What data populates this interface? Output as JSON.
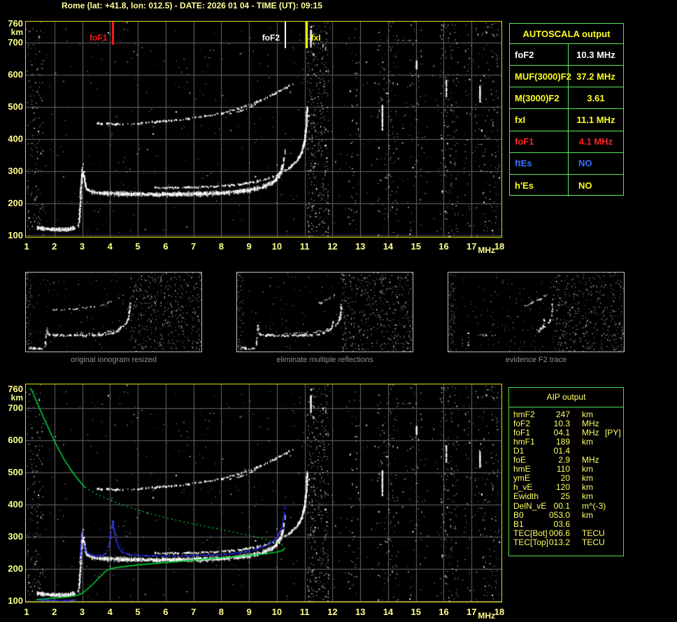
{
  "title": "Rome (lat: +41.8, lon: 012.5) - DATE: 2026 01 04 - TIME (UT): 09:15",
  "axis": {
    "x_ticks": [
      "1",
      "2",
      "3",
      "4",
      "5",
      "6",
      "7",
      "8",
      "9",
      "10",
      "11",
      "12",
      "13",
      "14",
      "15",
      "16",
      "17",
      "18"
    ],
    "y_ticks": [
      "760",
      "700",
      "600",
      "500",
      "400",
      "300",
      "200",
      "100"
    ],
    "x_unit": "MHz",
    "y_unit": "km"
  },
  "top_plot": {
    "markers": [
      {
        "label": "foF1",
        "f": 4.08,
        "color": "#ff1616",
        "side": "left",
        "len": 33,
        "w": 3
      },
      {
        "label": "foF2",
        "f": 10.28,
        "color": "#ffffff",
        "side": "left",
        "len": 38,
        "w": 2
      },
      {
        "label": "fxI",
        "f": 11.05,
        "color": "#ffff00",
        "side": "right",
        "len": 38,
        "w": 3
      }
    ]
  },
  "autoscala": {
    "header": "AUTOSCALA output",
    "rows": [
      {
        "label": "foF2",
        "value": "10.3 MHz",
        "color": "#ffffff",
        "align": "center"
      },
      {
        "label": "MUF(3000)F2",
        "value": "37.2 MHz",
        "color": "#ffff22",
        "align": "center"
      },
      {
        "label": "M(3000)F2",
        "value": "3.61",
        "color": "#ffff22",
        "align": "center"
      },
      {
        "label": "fxI",
        "value": "11.1 MHz",
        "color": "#ffff22",
        "align": "center"
      },
      {
        "label": "foF1",
        "value": "4.1 MHz",
        "color": "#ff2020",
        "align": "center"
      },
      {
        "label": "ftEs",
        "value": "NO",
        "color": "#3b6eff",
        "align": "left"
      },
      {
        "label": "h'Es",
        "value": "NO",
        "color": "#ffff22",
        "align": "left"
      }
    ]
  },
  "thumbnails": [
    {
      "caption": "original ionogram resized"
    },
    {
      "caption": "eliminate multiple reflections"
    },
    {
      "caption": "evidence F2 trace"
    }
  ],
  "aip": {
    "header": "AIP output",
    "rows": [
      {
        "label": "hmF2",
        "value": "247",
        "unit": "km",
        "extra": ""
      },
      {
        "label": "foF2",
        "value": "10.3",
        "unit": "MHz",
        "extra": ""
      },
      {
        "label": "foF1",
        "value": "04.1",
        "unit": "MHz",
        "extra": "[PY]"
      },
      {
        "label": "hmF1",
        "value": "189",
        "unit": "km",
        "extra": ""
      },
      {
        "label": "D1",
        "value": "01.4",
        "unit": "",
        "extra": ""
      },
      {
        "label": "foE",
        "value": "2.9",
        "unit": "MHz",
        "extra": ""
      },
      {
        "label": "hmE",
        "value": "110",
        "unit": "km",
        "extra": ""
      },
      {
        "label": "ymE",
        "value": "20",
        "unit": "km",
        "extra": ""
      },
      {
        "label": "h_vE",
        "value": "120",
        "unit": "km",
        "extra": ""
      },
      {
        "label": "Ewidth",
        "value": "25",
        "unit": "km",
        "extra": ""
      },
      {
        "label": "DelN_vE",
        "value": "00.1",
        "unit": "m^(-3)",
        "extra": ""
      },
      {
        "label": "B0",
        "value": "053.0",
        "unit": "km",
        "extra": ""
      },
      {
        "label": "B1",
        "value": "03.6",
        "unit": "",
        "extra": ""
      },
      {
        "label": "TEC[Bot]",
        "value": "006.6",
        "unit": "TECU",
        "extra": ""
      },
      {
        "label": "TEC[Top]",
        "value": "013.2",
        "unit": "TECU",
        "extra": ""
      }
    ]
  },
  "chart_data": {
    "type": "scatter",
    "title": "vertical incidence ionogram",
    "x_unit": "MHz",
    "y_unit": "km",
    "x_range": [
      1,
      18
    ],
    "y_range": [
      100,
      760
    ],
    "scaled_values": {
      "foF2_MHz": 10.3,
      "MUF3000F2_MHz": 37.2,
      "M3000F2": 3.61,
      "fxI_MHz": 11.1,
      "foF1_MHz": 4.1,
      "ftEs": "NO",
      "h_Es": "NO"
    },
    "traces": {
      "e_layer": [
        [
          1.4,
          124
        ],
        [
          1.6,
          121
        ],
        [
          1.9,
          119
        ],
        [
          2.2,
          118
        ],
        [
          2.5,
          119
        ],
        [
          2.75,
          122
        ]
      ],
      "f_cusp": [
        [
          2.86,
          128
        ],
        [
          2.9,
          150
        ],
        [
          2.92,
          180
        ],
        [
          2.94,
          215
        ],
        [
          2.96,
          250
        ],
        [
          2.99,
          285
        ],
        [
          3.02,
          315
        ],
        [
          3.04,
          330
        ]
      ],
      "f_desc": [
        [
          3.05,
          298
        ],
        [
          3.09,
          268
        ],
        [
          3.14,
          250
        ],
        [
          3.22,
          241
        ],
        [
          3.35,
          235
        ]
      ],
      "f_flat": [
        [
          3.35,
          235
        ],
        [
          3.8,
          231
        ],
        [
          4.5,
          229
        ],
        [
          5.5,
          228
        ],
        [
          6.5,
          228
        ],
        [
          7.5,
          230
        ],
        [
          8.2,
          233
        ],
        [
          8.8,
          238
        ],
        [
          9.2,
          244
        ],
        [
          9.5,
          251
        ],
        [
          9.75,
          260
        ],
        [
          9.95,
          272
        ],
        [
          10.1,
          288
        ],
        [
          10.18,
          305
        ],
        [
          10.24,
          325
        ],
        [
          10.27,
          350
        ],
        [
          10.29,
          378
        ]
      ],
      "x_mode": [
        [
          5.6,
          249
        ],
        [
          6.3,
          248
        ],
        [
          7.0,
          249
        ],
        [
          7.7,
          251
        ],
        [
          8.3,
          255
        ],
        [
          8.8,
          260
        ],
        [
          9.2,
          266
        ],
        [
          9.6,
          274
        ],
        [
          9.9,
          283
        ],
        [
          10.2,
          296
        ],
        [
          10.5,
          313
        ],
        [
          10.75,
          335
        ],
        [
          10.9,
          360
        ],
        [
          11.0,
          392
        ],
        [
          11.05,
          430
        ],
        [
          11.08,
          470
        ],
        [
          11.1,
          500
        ]
      ],
      "hop2": [
        [
          3.35,
          452
        ],
        [
          3.7,
          448
        ],
        [
          4.2,
          446
        ],
        [
          4.8,
          447
        ],
        [
          5.5,
          451
        ],
        [
          6.2,
          457
        ],
        [
          6.8,
          463
        ],
        [
          7.4,
          470
        ],
        [
          7.9,
          478
        ],
        [
          8.4,
          489
        ],
        [
          8.9,
          502
        ],
        [
          9.3,
          515
        ],
        [
          9.7,
          530
        ],
        [
          10.05,
          546
        ],
        [
          10.35,
          560
        ],
        [
          10.6,
          572
        ]
      ],
      "hop2b": [
        [
          8.3,
          478
        ],
        [
          8.7,
          487
        ],
        [
          9.0,
          497
        ],
        [
          9.25,
          508
        ]
      ]
    },
    "profile_green": {
      "bottomside": [
        [
          1.35,
          104
        ],
        [
          1.7,
          107
        ],
        [
          2.1,
          110
        ],
        [
          2.5,
          113
        ],
        [
          2.8,
          117
        ],
        [
          3.0,
          124
        ],
        [
          3.2,
          138
        ],
        [
          3.45,
          158
        ],
        [
          3.65,
          176
        ],
        [
          3.85,
          193
        ],
        [
          3.98,
          200
        ],
        [
          4.3,
          205
        ],
        [
          5.0,
          212
        ],
        [
          5.8,
          218
        ],
        [
          6.6,
          224
        ],
        [
          7.4,
          230
        ],
        [
          8.2,
          236
        ],
        [
          9.0,
          242
        ],
        [
          9.6,
          247
        ],
        [
          10.0,
          252
        ],
        [
          10.2,
          257
        ],
        [
          10.28,
          262
        ]
      ],
      "topside_dotted": [
        [
          10.28,
          262
        ],
        [
          10.22,
          272
        ],
        [
          10.05,
          280
        ],
        [
          9.7,
          289
        ],
        [
          9.2,
          300
        ],
        [
          8.5,
          313
        ],
        [
          7.7,
          327
        ],
        [
          6.9,
          341
        ],
        [
          6.1,
          357
        ],
        [
          5.3,
          375
        ],
        [
          4.6,
          394
        ],
        [
          4.0,
          413
        ],
        [
          3.5,
          433
        ],
        [
          3.1,
          453
        ]
      ],
      "topside_solid": [
        [
          3.1,
          453
        ],
        [
          2.85,
          478
        ],
        [
          2.6,
          507
        ],
        [
          2.35,
          540
        ],
        [
          2.1,
          580
        ],
        [
          1.85,
          625
        ],
        [
          1.6,
          672
        ],
        [
          1.4,
          712
        ],
        [
          1.22,
          748
        ],
        [
          1.13,
          762
        ]
      ]
    },
    "synth_blue": {
      "cusp3": [
        [
          2.93,
          230
        ],
        [
          2.95,
          262
        ],
        [
          2.97,
          292
        ],
        [
          2.99,
          316
        ]
      ],
      "main": [
        [
          3.06,
          277
        ],
        [
          3.12,
          256
        ],
        [
          3.25,
          246
        ],
        [
          3.45,
          241
        ],
        [
          3.7,
          240
        ],
        [
          3.85,
          247
        ],
        [
          3.95,
          268
        ],
        [
          4.02,
          298
        ],
        [
          4.07,
          330
        ],
        [
          4.1,
          347
        ],
        [
          4.15,
          322
        ],
        [
          4.22,
          290
        ],
        [
          4.32,
          265
        ],
        [
          4.45,
          251
        ],
        [
          4.7,
          244
        ],
        [
          5.2,
          241
        ],
        [
          6.0,
          240
        ],
        [
          7.0,
          241
        ],
        [
          7.8,
          243
        ],
        [
          8.4,
          247
        ],
        [
          8.9,
          253
        ],
        [
          9.3,
          261
        ],
        [
          9.6,
          271
        ],
        [
          9.85,
          284
        ],
        [
          10.02,
          300
        ],
        [
          10.13,
          318
        ],
        [
          10.2,
          338
        ],
        [
          10.25,
          358
        ],
        [
          10.27,
          375
        ],
        [
          10.29,
          392
        ]
      ],
      "e_blue": [
        [
          1.45,
          104
        ],
        [
          1.9,
          102
        ],
        [
          2.4,
          101
        ],
        [
          2.75,
          103
        ]
      ],
      "plus_marks": [
        [
          4.02,
          298
        ],
        [
          4.07,
          330
        ],
        [
          4.1,
          347
        ]
      ]
    }
  }
}
